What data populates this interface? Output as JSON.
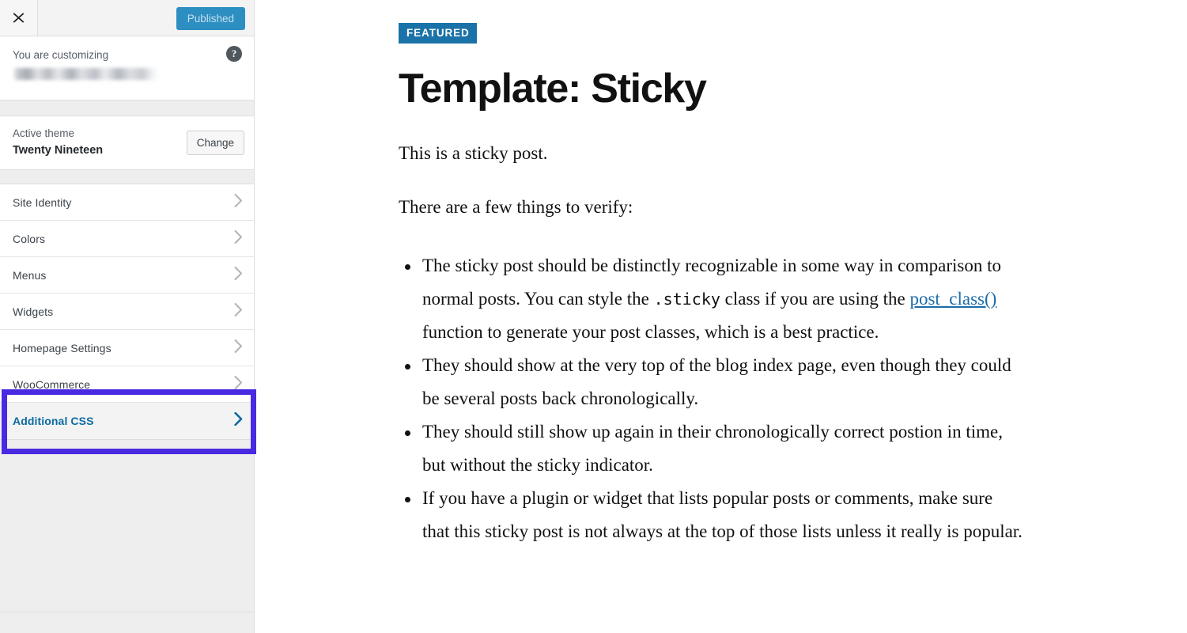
{
  "sidebar": {
    "header": {
      "close_icon": "close-x-icon",
      "publish_label": "Published",
      "publish_color": "#2d8ec1"
    },
    "info": {
      "customizing_label": "You are customizing",
      "site_title": "",
      "site_title_redacted": true,
      "help_icon": "help-question-icon",
      "help_glyph": "?"
    },
    "theme": {
      "label": "Active theme",
      "name": "Twenty Nineteen",
      "change_label": "Change"
    },
    "items": [
      {
        "label": "Site Identity",
        "icon": "chevron-right-icon",
        "active": false
      },
      {
        "label": "Colors",
        "icon": "chevron-right-icon",
        "active": false
      },
      {
        "label": "Menus",
        "icon": "chevron-right-icon",
        "active": false
      },
      {
        "label": "Widgets",
        "icon": "chevron-right-icon",
        "active": false
      },
      {
        "label": "Homepage Settings",
        "icon": "chevron-right-icon",
        "active": false
      },
      {
        "label": "WooCommerce",
        "icon": "chevron-right-icon",
        "active": false
      },
      {
        "label": "Additional CSS",
        "icon": "chevron-right-icon",
        "active": true
      }
    ]
  },
  "annotation": {
    "target": "Additional CSS",
    "color": "#4a2ae0"
  },
  "preview": {
    "badge": "FEATURED",
    "badge_color": "#1b72a8",
    "title": "Template: Sticky",
    "paragraphs": [
      "This is a sticky post.",
      "There are a few things to verify:"
    ],
    "bullets": [
      {
        "part1": "The sticky post should be distinctly recognizable in some way in comparison to normal posts. You can style the ",
        "code1": ".sticky",
        "part2": " class if you are using the ",
        "link": "post_class()",
        "part3": " function to generate your post classes, which is a best practice."
      },
      {
        "part1": "They should show at the very top of the blog index page, even though they could be several posts back chronologically.",
        "code1": "",
        "part2": "",
        "link": "",
        "part3": ""
      },
      {
        "part1": "They should still show up again in their chronologically correct postion in time, but without the sticky indicator.",
        "code1": "",
        "part2": "",
        "link": "",
        "part3": ""
      },
      {
        "part1": "If you have a plugin or widget that lists popular posts or comments, make sure that this sticky post is not always at the top of those lists unless it really is popular.",
        "code1": "",
        "part2": "",
        "link": "",
        "part3": ""
      }
    ]
  }
}
